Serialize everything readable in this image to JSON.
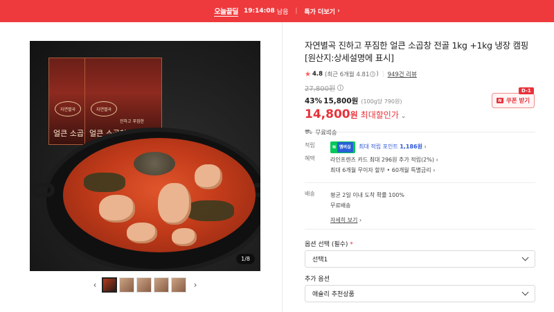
{
  "banner": {
    "tag": "오늘끝딜",
    "timer": "19:14:08",
    "remaining": "남음",
    "more": "특가 더보기"
  },
  "gallery": {
    "counter": "1/8",
    "package_brand": "자연별곡",
    "package_name": "얼큰 소곱창전골",
    "package_sub": "진하고 푸짐한",
    "thumbnails": [
      "thumb-1",
      "thumb-2",
      "thumb-3",
      "thumb-4",
      "thumb-5"
    ]
  },
  "product": {
    "title": "자연별곡 진하고 푸짐한 얼큰 소곱창 전골 1kg +1kg 냉장 캠핑 [원산지:상세설명에 표시]",
    "rating": "4.8",
    "rating_detail": "(최근 6개월 4.81",
    "rating_detail_close": ")",
    "reviews": "949건 리뷰",
    "original_price": "27,800원",
    "discount_pct": "43%",
    "discount_price": "15,800원",
    "unit_price": "(100g당 790원)",
    "final_price": "14,800",
    "final_won": "원",
    "max_label": "최대할인가",
    "coupon_label": "쿠폰 받기",
    "coupon_dday": "D-1",
    "shipping": "무료배송"
  },
  "points": {
    "label": "적립",
    "badge_n": "N",
    "badge_plus": "멤버십",
    "text_prefix": "최대 적립 포인트",
    "amount": "1,186원",
    "chev": "›"
  },
  "benefits": {
    "label": "혜택",
    "line1": "라인프렌즈 카드 최대 296원 추가 적립(2%)",
    "line2": "최대 6개월 무이자 할부 • 60개월 특별금리",
    "chev": "›"
  },
  "delivery": {
    "label": "배송",
    "line1": "평균 2일 이내 도착 확률 100%",
    "line2": "무료배송",
    "more": "자세히 보기",
    "chev": "›"
  },
  "options": {
    "required_label": "옵션 선택 (필수)",
    "required_mark": "*",
    "required_value": "선택1",
    "extra_label": "추가 옵션",
    "extra_value": "애슐리 추천상품"
  }
}
